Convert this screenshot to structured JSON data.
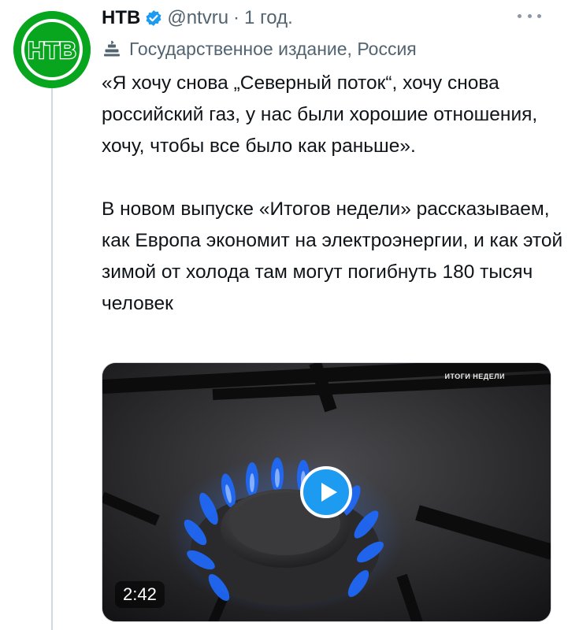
{
  "tweet": {
    "author_name": "НТВ",
    "handle": "@ntvru",
    "separator": "·",
    "time": "1 год.",
    "label": "Государственное издание, Россия",
    "paragraphs": [
      "«Я хочу снова „Северный поток“, хочу снова российский газ, у нас были хорошие отношения, хочу, чтобы все было как раньше».",
      "В новом выпуске «Итогов недели» рассказываем, как Европа экономит на электроэнергии, и как этой зимой от холода там могут погибнуть 180 тысяч человек"
    ]
  },
  "avatar": {
    "logo_text": "НТВ",
    "color": "#08a61f"
  },
  "media": {
    "watermark": "ИТОГИ НЕДЕЛИ",
    "duration": "2:42",
    "flame_color": "#1e6bff"
  },
  "colors": {
    "accent": "#1d9bf0",
    "muted": "#536471",
    "text": "#0f1419"
  }
}
